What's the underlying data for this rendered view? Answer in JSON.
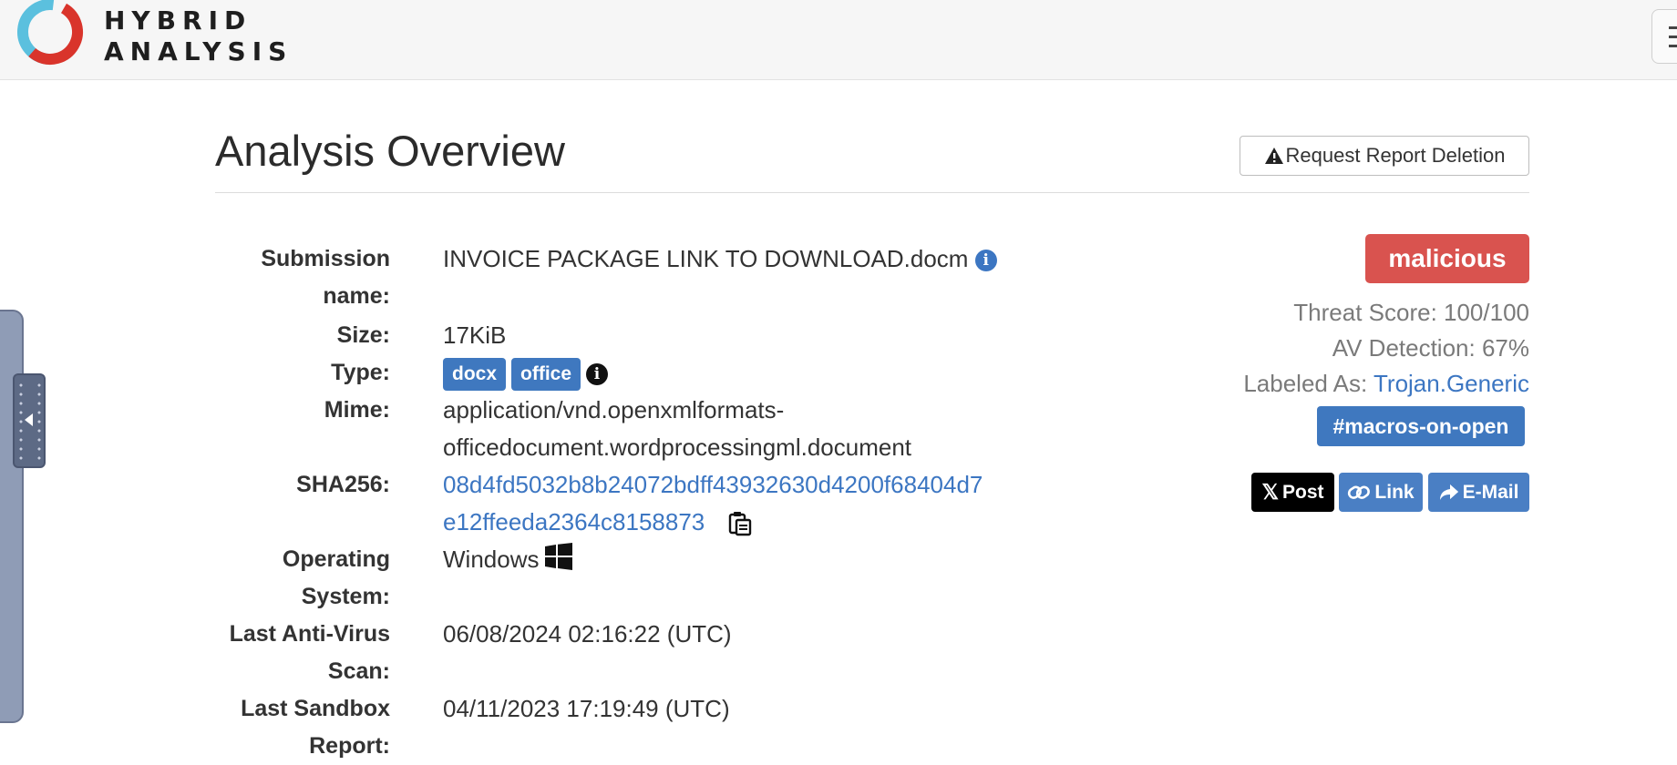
{
  "header": {
    "brand_line1": "HYBRID",
    "brand_line2": "ANALYSIS",
    "logo_colors": {
      "ring_blue": "#5bc0de",
      "ring_red": "#d9342b"
    }
  },
  "page": {
    "title": "Analysis Overview",
    "request_deletion_label": "Request Report Deletion"
  },
  "details": {
    "submission_name_label": "Submission name:",
    "submission_name": "INVOICE PACKAGE LINK TO DOWNLOAD.docm",
    "size_label": "Size:",
    "size": "17KiB",
    "type_label": "Type:",
    "type_tags": [
      "docx",
      "office"
    ],
    "mime_label": "Mime:",
    "mime_line1": "application/vnd.openxmlformats-",
    "mime_line2": "officedocument.wordprocessingml.document",
    "sha_label": "SHA256:",
    "sha_line1": "08d4fd5032b8b24072bdff43932630d4200f68404d7",
    "sha_line2": "e12ffeeda2364c8158873",
    "os_label": "Operating System:",
    "os": "Windows",
    "last_av_label": "Last Anti-Virus Scan:",
    "last_av": "06/08/2024 02:16:22 (UTC)",
    "last_sandbox_label": "Last Sandbox Report:",
    "last_sandbox": "04/11/2023 17:19:49 (UTC)"
  },
  "summary": {
    "verdict": "malicious",
    "verdict_color": "#d9534f",
    "threat_score": "Threat Score: 100/100",
    "av_detection": "AV Detection: 67%",
    "labeled_as_prefix": "Labeled As:",
    "labeled_as": "Trojan.Generic",
    "hashtag": "#macros-on-open",
    "share_x": "Post",
    "share_link": "Link",
    "share_email": "E-Mail"
  }
}
